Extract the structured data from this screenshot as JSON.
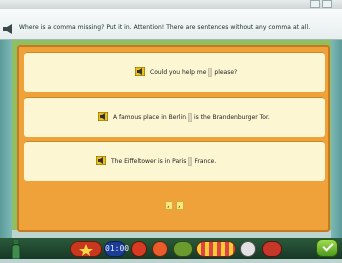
{
  "instructions": {
    "text": "Where is a comma missing? Put it in. Attention! There are sentences without any comma at all."
  },
  "sentences": [
    {
      "parts": [
        "Could you help me",
        "please?"
      ]
    },
    {
      "parts": [
        "A famous place in Berlin",
        "is the Brandenburger Tor."
      ]
    },
    {
      "parts": [
        "The Eiffeltower is in Paris",
        "France."
      ]
    }
  ],
  "comma_tiles": [
    ",",
    ","
  ],
  "toolbar": {
    "clock": "01:00"
  },
  "colors": {
    "board": "#f0a23a",
    "card": "#fdf6d3",
    "ok": "#6bbf2a"
  }
}
